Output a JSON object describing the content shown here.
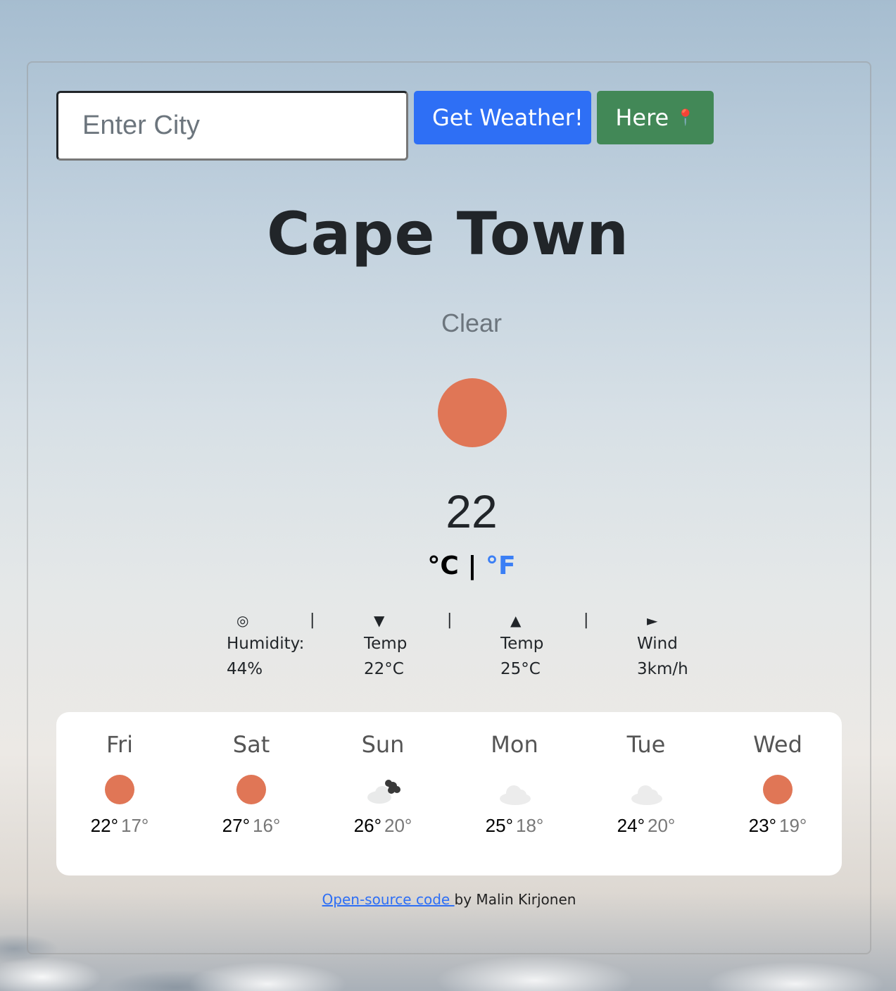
{
  "search": {
    "placeholder": "Enter City",
    "value": ""
  },
  "buttons": {
    "get_weather": "Get Weather!",
    "here": "Here",
    "here_icon": "📍"
  },
  "current": {
    "city": "Cape Town",
    "description": "Clear",
    "icon": "sun-icon",
    "temperature": "22",
    "unit_c": "°C",
    "unit_sep": " | ",
    "unit_f": "°F"
  },
  "details": [
    {
      "icon": "◎",
      "icon_name": "humidity-icon",
      "label": "Humidity:",
      "value": "44%"
    },
    {
      "icon": "▼",
      "icon_name": "min-temp-icon",
      "label": "Temp",
      "value": "22°C"
    },
    {
      "icon": "▲",
      "icon_name": "max-temp-icon",
      "label": "Temp",
      "value": "25°C"
    },
    {
      "icon": "►",
      "icon_name": "wind-icon",
      "label": "Wind",
      "value": "3km/h"
    }
  ],
  "separator": "|",
  "forecast": [
    {
      "day": "Fri",
      "icon": "sun-icon",
      "hi": "22°",
      "lo": "17°"
    },
    {
      "day": "Sat",
      "icon": "sun-icon",
      "hi": "27°",
      "lo": "16°"
    },
    {
      "day": "Sun",
      "icon": "cloud-icon",
      "hi": "26°",
      "lo": "20°"
    },
    {
      "day": "Mon",
      "icon": "cloud-icon",
      "hi": "25°",
      "lo": "18°"
    },
    {
      "day": "Tue",
      "icon": "cloud-icon",
      "hi": "24°",
      "lo": "20°"
    },
    {
      "day": "Wed",
      "icon": "sun-icon",
      "hi": "23°",
      "lo": "19°"
    }
  ],
  "footer": {
    "link_text": "Open-source code ",
    "author": "by Malin Kirjonen"
  },
  "colors": {
    "sun": "#e07656",
    "primary": "#2e6ff5",
    "success": "#428857",
    "link": "#3b7ff5"
  }
}
